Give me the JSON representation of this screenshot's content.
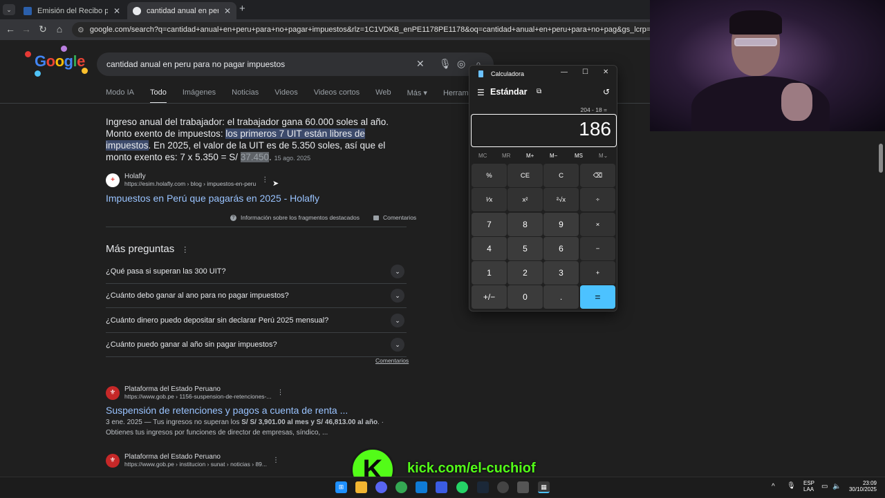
{
  "browser": {
    "tabs": [
      {
        "title": "Emisión del Recibo por Honorarios",
        "favicon_color": "#2b5fab"
      },
      {
        "title": "cantidad anual en peru para no pagar impuestos",
        "favicon_color": "#e8eaed"
      }
    ],
    "address": "google.com/search?q=cantidad+anual+en+peru+para+no+pagar+impuestos&rlz=1C1VDKB_enPE1178PE1178&oq=cantidad+anual+en+peru+para+no+pag&gs_lcrp=EgZjaHJvbWUqBwgBECEYoA"
  },
  "google": {
    "query": "cantidad anual en peru para no pagar impuestos",
    "tabs": [
      "Modo IA",
      "Todo",
      "Imágenes",
      "Noticias",
      "Videos",
      "Videos cortos",
      "Web",
      "Más ▾",
      "Herramientas ▾"
    ],
    "snippet": {
      "p1": "Ingreso anual del trabajador: el trabajador gana 60.000 soles al año. Monto exento de impuestos: ",
      "hl": "los primeros 7 UIT están libres de impuestos",
      "p2": ". En 2025, el valor de la UIT es de 5.350 soles, así que el monto exento es: 7 x 5.350 = S/ ",
      "num": "37.450",
      "p3": ".",
      "date": "15 ago. 2025"
    },
    "result1": {
      "site": "Holafly",
      "url": "https://esim.holafly.com › blog › impuestos-en-peru",
      "title": "Impuestos en Perú que pagarás en 2025 - Holafly"
    },
    "featured_info": "Información sobre los fragmentos destacados",
    "comments": "Comentarios",
    "paa_title": "Más preguntas",
    "paa": [
      "¿Qué pasa si superan las 300 UIT?",
      "¿Cuánto debo ganar al ano para no pagar impuestos?",
      "¿Cuánto dinero puedo depositar sin declarar Perú 2025 mensual?",
      "¿Cuánto puedo ganar al año sin pagar impuestos?"
    ],
    "result2": {
      "site": "Plataforma del Estado Peruano",
      "url": "https://www.gob.pe › 1156-suspension-de-retenciones-...",
      "title": "Suspensión de retenciones y pagos a cuenta de renta ...",
      "desc_a": "3 ene. 2025 — Tus ingresos no superan los ",
      "desc_b": "S/ S/ 3,901.00 al mes y S/ 46,813.00 al año",
      "desc_c": ". · Obtienes tus ingresos por funciones de director de empresas, síndico, ..."
    },
    "result3": {
      "site": "Plataforma del Estado Peruano",
      "url": "https://www.gob.pe › institucion › sunat › noticias › 89..."
    }
  },
  "calculator": {
    "title": "Calculadora",
    "mode": "Estándar",
    "expression": "204 - 18 =",
    "display": "186",
    "memory": [
      "MC",
      "MR",
      "M+",
      "M−",
      "MS",
      "M⌄"
    ],
    "keys": [
      [
        "%",
        "CE",
        "C",
        "⌫"
      ],
      [
        "¹⁄x",
        "x²",
        "²√x",
        "÷"
      ],
      [
        "7",
        "8",
        "9",
        "×"
      ],
      [
        "4",
        "5",
        "6",
        "−"
      ],
      [
        "1",
        "2",
        "3",
        "+"
      ],
      [
        "+/−",
        "0",
        ".",
        "="
      ]
    ]
  },
  "overlay": {
    "kick_letter": "K",
    "kick_url": "kick.com/el-cuchiof"
  },
  "taskbar": {
    "lang1": "ESP",
    "lang2": "LAA",
    "time": "23:09",
    "date": "30/10/2025"
  },
  "colors": {
    "accent": "#4cc2ff",
    "kick": "#53fc18",
    "link": "#99c3ff"
  }
}
